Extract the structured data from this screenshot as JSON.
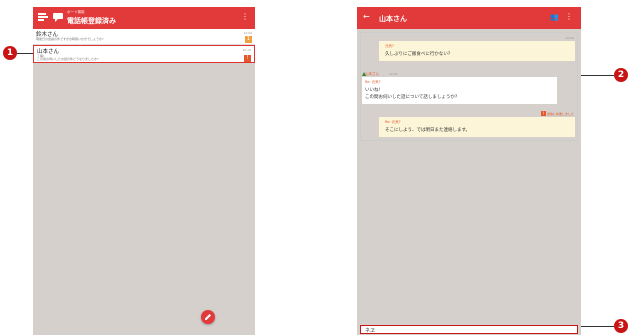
{
  "left": {
    "header": {
      "sub_label": "ボード機能",
      "title": "電話帳登録済み",
      "menu": "⋮"
    },
    "conversations": [
      {
        "name": "鈴木さん",
        "preview": "明後日の会議の件ですがお時間いかがでしょうか?",
        "time": "12:00",
        "badge": "1"
      },
      {
        "name": "山本さん",
        "preview": "了解!",
        "preview2": "この間お伺いしたお話の件どうなりましたか?",
        "time": "10:10",
        "badge": "!"
      }
    ],
    "fab_icon": "pencil-icon"
  },
  "right": {
    "header": {
      "back": "←",
      "title": "山本さん",
      "people": "👥",
      "menu": "⋮"
    },
    "messages": {
      "time_top": "10:00",
      "out1_quote": "元気?",
      "out1_text": "久しぶりにご飯食べに行かない?",
      "sender": "山本さん",
      "sender_time": "10:05",
      "in_quote": "Re: 元気?",
      "in_text1": "いいね!",
      "in_text2": "この間お伺いした話について話しましょうか?",
      "fail_badge": "!",
      "fail_text": "送信に失敗しました",
      "out2_quote": "Re: 元気?",
      "out2_text": "そこにしよう、では明日また連絡します。"
    },
    "input_value": "ネヱ"
  },
  "callouts": [
    "1",
    "2",
    "3"
  ]
}
